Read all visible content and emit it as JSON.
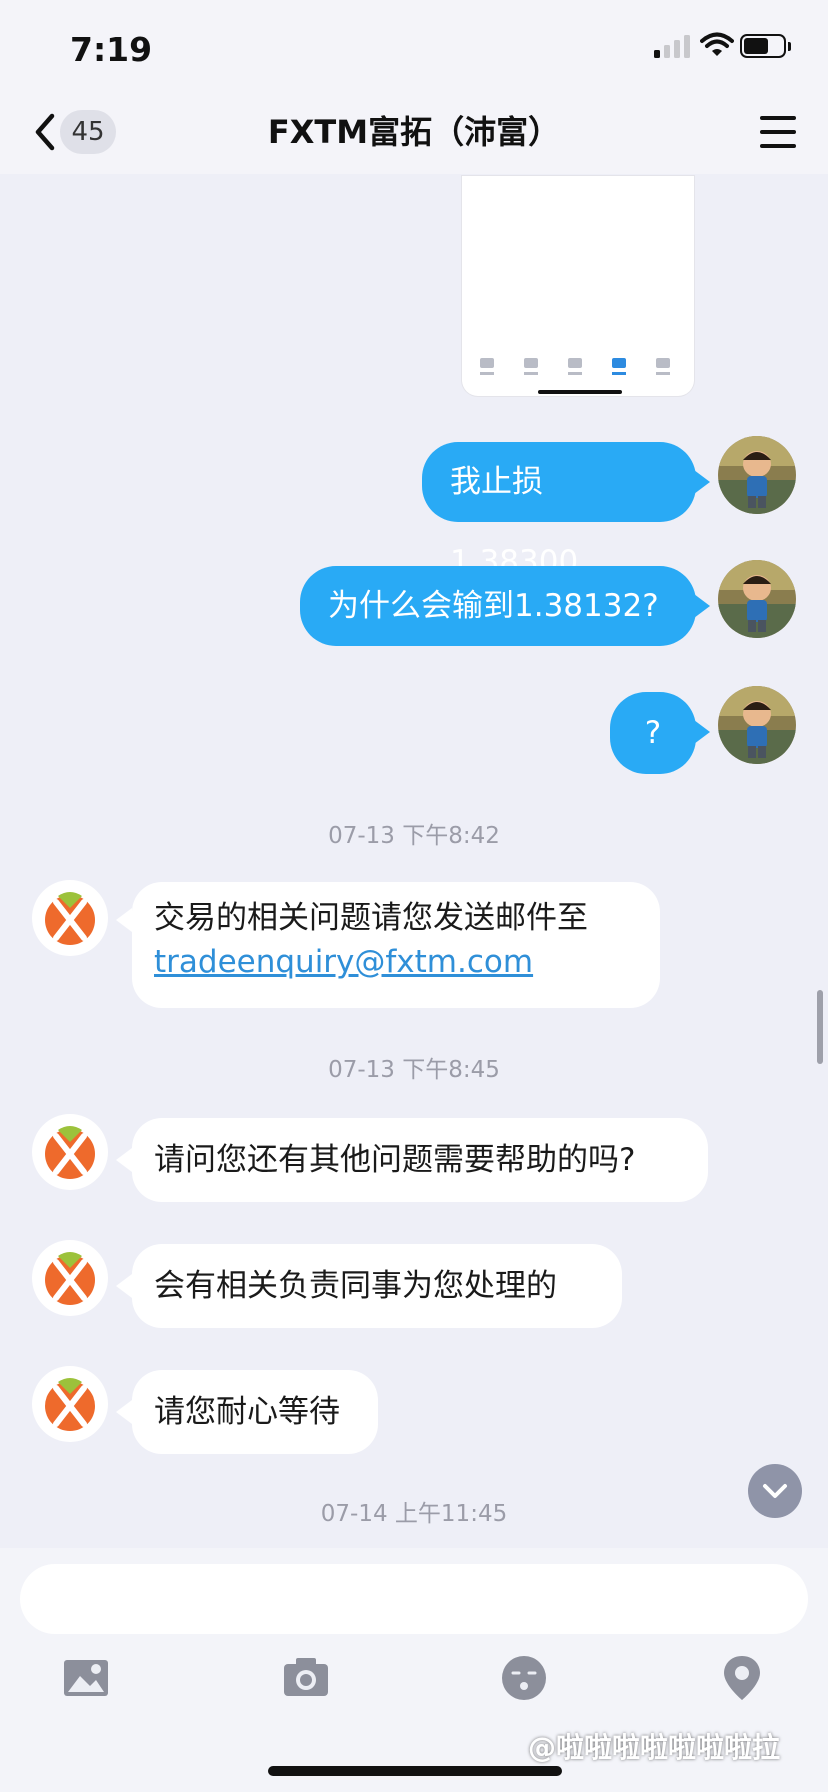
{
  "status_bar": {
    "time": "7:19"
  },
  "nav": {
    "back_count": "45",
    "title": "FXTM富拓（沛富）"
  },
  "messages": {
    "out1": "我止损1.38300",
    "out2": "为什么会输到1.38132?",
    "out3": "?",
    "ts1": "07-13 下午8:42",
    "in1_text": "交易的相关问题请您发送邮件至",
    "in1_email": "tradeenquiry@fxtm.com",
    "ts2": "07-13 下午8:45",
    "in2": "请问您还有其他问题需要帮助的吗?",
    "in3": "会有相关负责同事为您处理的",
    "in4": "请您耐心等待",
    "ts3": "07-14 上午11:45"
  },
  "composer": {
    "input_value": "",
    "input_placeholder": ""
  },
  "watermark": "@啦啦啦啦啦啦啦拉",
  "colors": {
    "outgoing_bubble": "#29aaf5",
    "bot_brand_orange": "#ee6a2c",
    "bot_brand_green": "#9cc23b",
    "link": "#2f8fd8"
  },
  "icons": [
    "back-chevron-icon",
    "menu-icon",
    "photo-icon",
    "camera-icon",
    "emoji-icon",
    "location-icon",
    "scroll-down-icon"
  ]
}
